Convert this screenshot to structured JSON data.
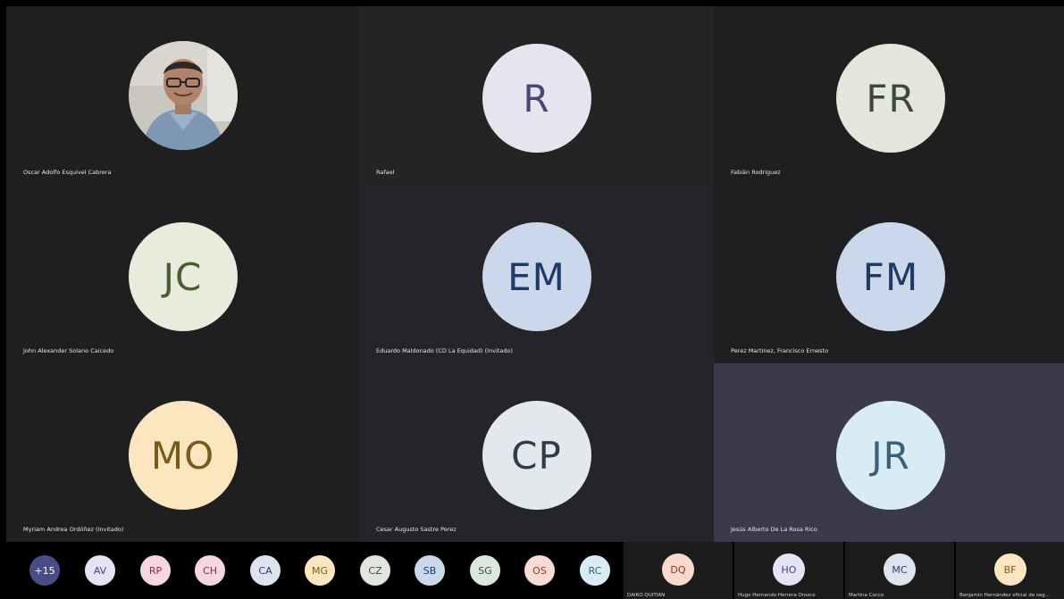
{
  "tiles": [
    {
      "name": "Oscar Adolfo Esquivel Cabrera",
      "type": "photo"
    },
    {
      "name": "Rafael",
      "initials": "R",
      "bg": "#e7e4f0",
      "fg": "#464775"
    },
    {
      "name": "Fabián Rodriguez",
      "initials": "FR",
      "bg": "#e4e6dc",
      "fg": "#3c4a35"
    },
    {
      "name": "John Alexander Solano Caicedo",
      "initials": "JC",
      "bg": "#e8ecdc",
      "fg": "#4f5b33"
    },
    {
      "name": "Eduardo Maldonado (CD La Equidad) (Invitado)",
      "initials": "EM",
      "bg": "#cbd8ec",
      "fg": "#1f3a64"
    },
    {
      "name": "Perez Martinez, Francisco Ernesto",
      "initials": "FM",
      "bg": "#cbd8ec",
      "fg": "#1f3a64"
    },
    {
      "name": "Myriam Andrea Ordóñez (Invitado)",
      "initials": "MO",
      "bg": "#fbe6bf",
      "fg": "#7a5a1a"
    },
    {
      "name": "Cesar Augusto Sastre Perez",
      "initials": "CP",
      "bg": "#e2e8ec",
      "fg": "#2e3e48"
    },
    {
      "name": "Jesús Alberto De La Rosa Rico",
      "initials": "JR",
      "bg": "#d8ecf3",
      "fg": "#3a6276"
    }
  ],
  "strip_chips": [
    {
      "label": "+15",
      "bg": "#4a4c86",
      "fg": "#ffffff"
    },
    {
      "label": "AV",
      "bg": "#e4e4f4",
      "fg": "#464775"
    },
    {
      "label": "RP",
      "bg": "#f6d7df",
      "fg": "#8a2943"
    },
    {
      "label": "CH",
      "bg": "#f6d7df",
      "fg": "#8a2943"
    },
    {
      "label": "CA",
      "bg": "#dde3ef",
      "fg": "#2c3e63"
    },
    {
      "label": "MG",
      "bg": "#fbe6bf",
      "fg": "#7a5a1a"
    },
    {
      "label": "CZ",
      "bg": "#e2e6e0",
      "fg": "#3c4a35"
    },
    {
      "label": "SB",
      "bg": "#cbd8ec",
      "fg": "#1f3a64"
    },
    {
      "label": "SG",
      "bg": "#dbe9dd",
      "fg": "#2e5a3a"
    },
    {
      "label": "OS",
      "bg": "#f8dcd4",
      "fg": "#8a3a22"
    },
    {
      "label": "RC",
      "bg": "#d8ecf3",
      "fg": "#3a6276"
    }
  ],
  "strip_tiles": [
    {
      "initials": "DQ",
      "name": "DAIRO QUITIAN",
      "bg": "#fbd9cd",
      "fg": "#8a3a22"
    },
    {
      "initials": "HO",
      "name": "Hugo Hernando Herrera Orozco",
      "bg": "#e4e4f4",
      "fg": "#464775"
    },
    {
      "initials": "MC",
      "name": "Martina Cocco",
      "bg": "#dde3ef",
      "fg": "#2c3e63"
    },
    {
      "initials": "BF",
      "name": "Benjamín Hernández oficial de seg...",
      "bg": "#fbe6bf",
      "fg": "#7a5a1a"
    }
  ]
}
